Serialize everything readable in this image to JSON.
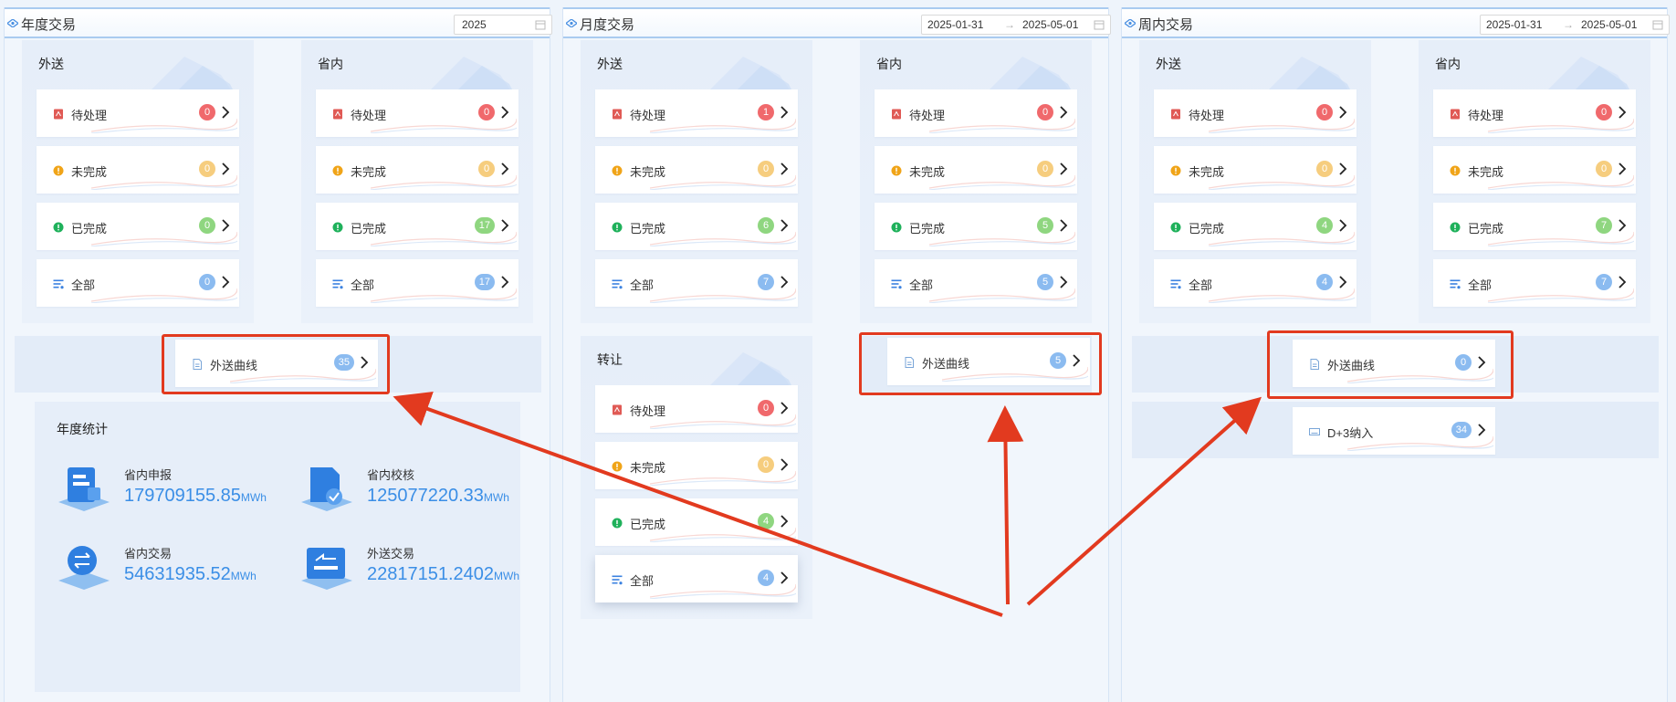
{
  "panels": {
    "annual": {
      "title": "年度交易",
      "year": "2025",
      "groups": {
        "outbound": {
          "title": "外送",
          "items": [
            {
              "label": "待处理",
              "count": "0"
            },
            {
              "label": "未完成",
              "count": "0"
            },
            {
              "label": "已完成",
              "count": "0"
            },
            {
              "label": "全部",
              "count": "0"
            }
          ]
        },
        "province": {
          "title": "省内",
          "items": [
            {
              "label": "待处理",
              "count": "0"
            },
            {
              "label": "未完成",
              "count": "0"
            },
            {
              "label": "已完成",
              "count": "17"
            },
            {
              "label": "全部",
              "count": "17"
            }
          ]
        }
      },
      "curve": {
        "label": "外送曲线",
        "count": "35"
      },
      "stats": {
        "title": "年度统计",
        "items": [
          {
            "label": "省内申报",
            "value": "179709155.85",
            "unit": "MWh"
          },
          {
            "label": "省内校核",
            "value": "125077220.33",
            "unit": "MWh"
          },
          {
            "label": "省内交易",
            "value": "54631935.52",
            "unit": "MWh"
          },
          {
            "label": "外送交易",
            "value": "22817151.2402",
            "unit": "MWh"
          }
        ]
      }
    },
    "monthly": {
      "title": "月度交易",
      "date_start": "2025-01-31",
      "date_end": "2025-05-01",
      "groups": {
        "outbound": {
          "title": "外送",
          "items": [
            {
              "label": "待处理",
              "count": "1"
            },
            {
              "label": "未完成",
              "count": "0"
            },
            {
              "label": "已完成",
              "count": "6"
            },
            {
              "label": "全部",
              "count": "7"
            }
          ]
        },
        "province": {
          "title": "省内",
          "items": [
            {
              "label": "待处理",
              "count": "0"
            },
            {
              "label": "未完成",
              "count": "0"
            },
            {
              "label": "已完成",
              "count": "5"
            },
            {
              "label": "全部",
              "count": "5"
            }
          ]
        },
        "transfer": {
          "title": "转让",
          "items": [
            {
              "label": "待处理",
              "count": "0"
            },
            {
              "label": "未完成",
              "count": "0"
            },
            {
              "label": "已完成",
              "count": "4"
            },
            {
              "label": "全部",
              "count": "4"
            }
          ]
        }
      },
      "curve": {
        "label": "外送曲线",
        "count": "5"
      }
    },
    "weekly": {
      "title": "周内交易",
      "date_start": "2025-01-31",
      "date_end": "2025-05-01",
      "groups": {
        "outbound": {
          "title": "外送",
          "items": [
            {
              "label": "待处理",
              "count": "0"
            },
            {
              "label": "未完成",
              "count": "0"
            },
            {
              "label": "已完成",
              "count": "4"
            },
            {
              "label": "全部",
              "count": "4"
            }
          ]
        },
        "province": {
          "title": "省内",
          "items": [
            {
              "label": "待处理",
              "count": "0"
            },
            {
              "label": "未完成",
              "count": "0"
            },
            {
              "label": "已完成",
              "count": "7"
            },
            {
              "label": "全部",
              "count": "7"
            }
          ]
        }
      },
      "curve": {
        "label": "外送曲线",
        "count": "0"
      },
      "d3": {
        "label": "D+3纳入",
        "count": "34"
      }
    }
  },
  "date_separator": "→",
  "colors": {
    "pending": "#f0696c",
    "incomplete": "#f6cd7e",
    "done": "#8fd680",
    "all": "#8bbbf0",
    "highlight": "#e23a1f",
    "stat_value": "#3a8ee6"
  }
}
